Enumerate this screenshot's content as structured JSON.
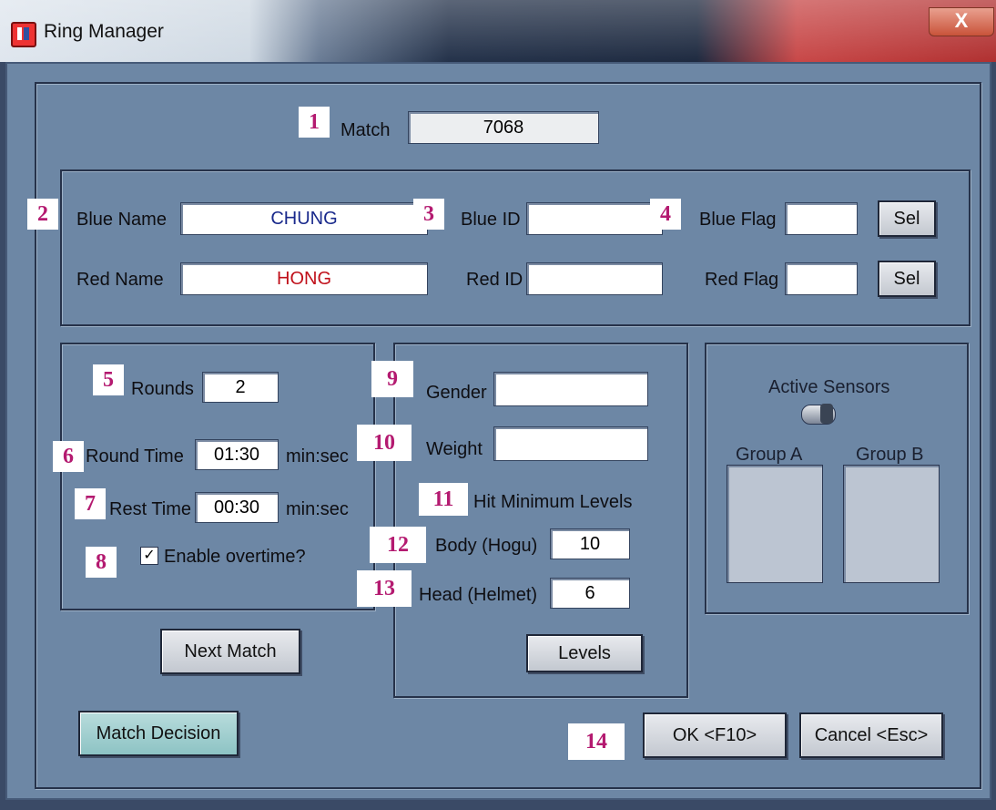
{
  "window": {
    "title": "Ring Manager",
    "close_glyph": "X"
  },
  "match": {
    "label": "Match",
    "value": "7068"
  },
  "blue": {
    "name_label": "Blue Name",
    "name_value": "CHUNG",
    "id_label": "Blue ID",
    "id_value": "",
    "flag_label": "Blue Flag",
    "flag_value": "",
    "sel_label": "Sel"
  },
  "red": {
    "name_label": "Red Name",
    "name_value": "HONG",
    "id_label": "Red ID",
    "id_value": "",
    "flag_label": "Red Flag",
    "flag_value": "",
    "sel_label": "Sel"
  },
  "timing": {
    "rounds_label": "Rounds",
    "rounds_value": "2",
    "round_time_label": "Round Time",
    "round_time_value": "01:30",
    "rest_time_label": "Rest Time",
    "rest_time_value": "00:30",
    "unit": "min:sec",
    "overtime_label": "Enable overtime?",
    "overtime_checked": true,
    "check_glyph": "✓"
  },
  "division": {
    "gender_label": "Gender",
    "gender_value": "",
    "weight_label": "Weight",
    "weight_value": "",
    "hit_min_label": "Hit Minimum Levels",
    "body_label": "Body (Hogu)",
    "body_value": "10",
    "head_label": "Head (Helmet)",
    "head_value": "6",
    "levels_button": "Levels"
  },
  "sensors": {
    "title": "Active Sensors",
    "group_a": "Group A",
    "group_b": "Group B"
  },
  "buttons": {
    "next_match": "Next Match",
    "match_decision": "Match Decision",
    "ok": "OK <F10>",
    "cancel": "Cancel <Esc>"
  },
  "badges": [
    "1",
    "2",
    "3",
    "4",
    "5",
    "6",
    "7",
    "8",
    "9",
    "10",
    "11",
    "12",
    "13",
    "14"
  ],
  "colors": {
    "blue_name": "#1a2a8c",
    "red_name": "#c0101a",
    "badge_text": "#b41a70",
    "dialog_bg": "#6d87a5"
  }
}
